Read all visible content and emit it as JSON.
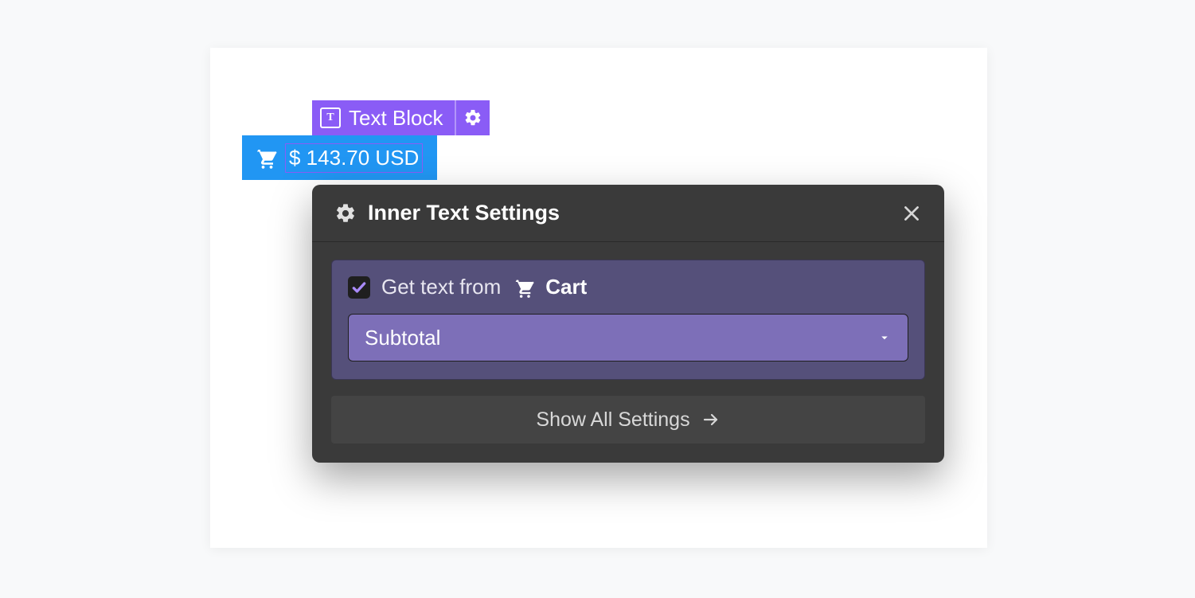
{
  "label": {
    "icon_glyph": "T",
    "text": "Text Block"
  },
  "cart": {
    "price": "$ 143.70 USD"
  },
  "panel": {
    "title": "Inner Text Settings",
    "get_text_label": "Get text from",
    "source_name": "Cart",
    "selected_field": "Subtotal",
    "show_all": "Show All Settings"
  }
}
